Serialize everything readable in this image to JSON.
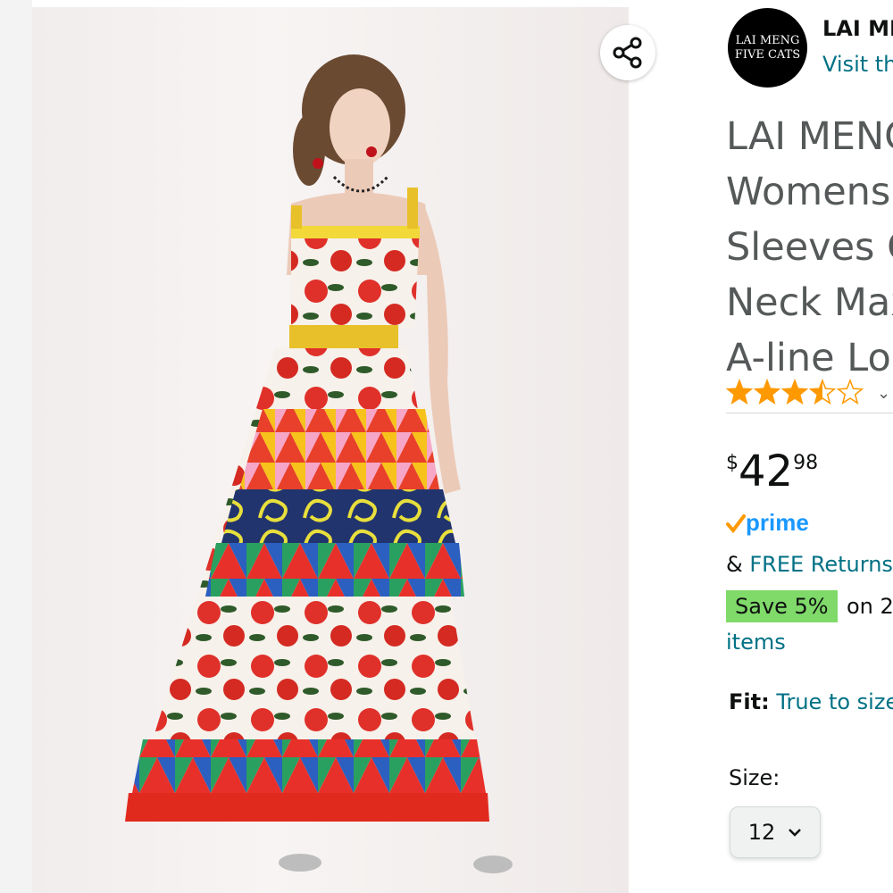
{
  "brand": {
    "logo_line1": "LAI MENG",
    "logo_line2": "FIVE CATS",
    "name": "LAI ME",
    "visit_link": "Visit th"
  },
  "product": {
    "title_lines": [
      "LAI MENG",
      "Womens",
      "Sleeves C",
      "Neck Max",
      "A-line Lo"
    ],
    "rating": 3.5,
    "price": {
      "symbol": "$",
      "whole": "42",
      "fraction": "98"
    },
    "prime_label": "prime",
    "returns_prefix": "& ",
    "returns_link": "FREE Returns",
    "save_badge": "Save 5%",
    "save_rest": "on 2",
    "items_link": "items",
    "fit_label": "Fit:",
    "fit_value": "True to size",
    "size_label": "Size:",
    "size_selected": "12"
  },
  "colors": {
    "link": "#007185",
    "star": "#ff9900",
    "save_badge": "#7fda69",
    "prime_blue": "#1a98ff",
    "prime_check": "#ff9900"
  },
  "icons": {
    "share": "share-icon",
    "rating_chevron": "chevron-down-icon",
    "size_chevron": "chevron-down-icon",
    "prime_check": "check-icon"
  }
}
